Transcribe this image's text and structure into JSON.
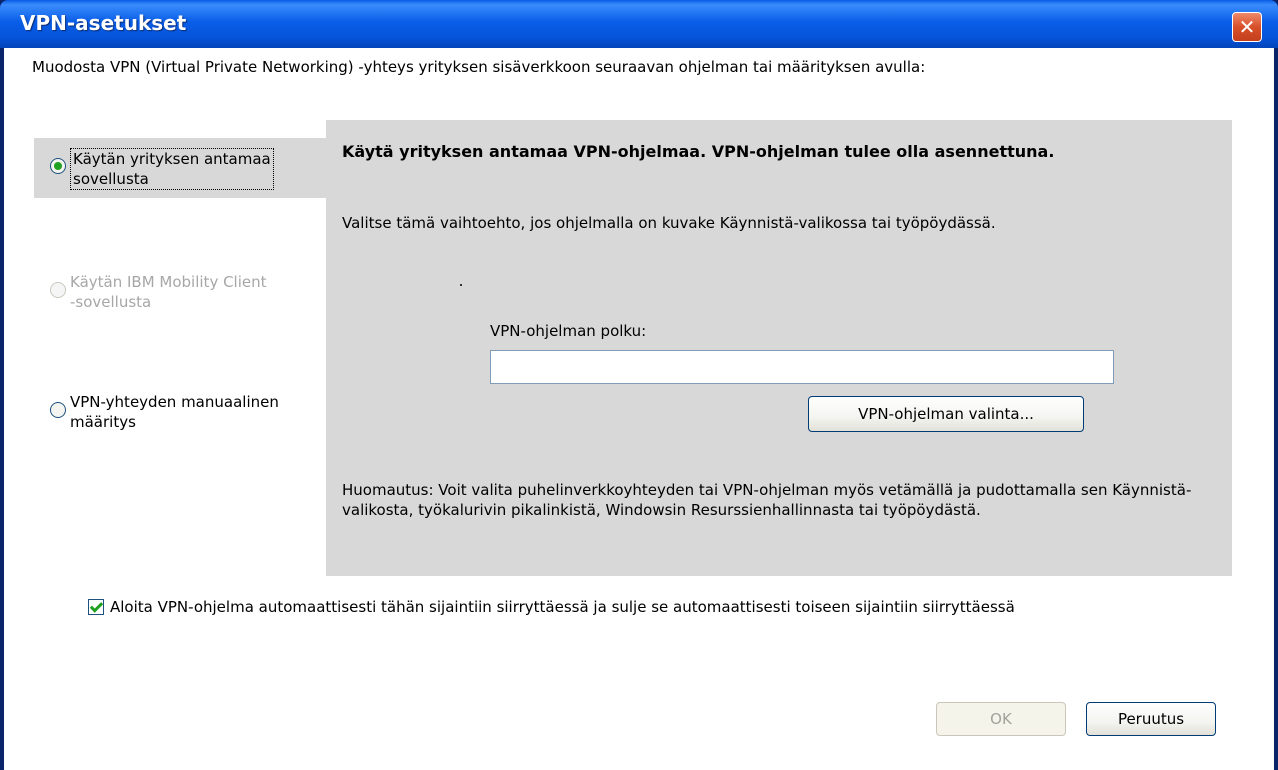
{
  "window": {
    "title": "VPN-asetukset",
    "close_glyph": "✕",
    "close_icon": "close-icon"
  },
  "intro_text": "Muodosta VPN (Virtual Private Networking) -yhteys yrityksen sisäverkkoon seuraavan ohjelman tai määrityksen avulla:",
  "options": [
    {
      "label_line1": "Käytän yrityksen antamaa",
      "label_line2": "sovellusta",
      "selected": true,
      "enabled": true
    },
    {
      "label_line1": "Käytän IBM Mobility Client",
      "label_line2": "-sovellusta",
      "selected": false,
      "enabled": false
    },
    {
      "label_line1": "VPN-yhteyden manuaalinen",
      "label_line2": "määritys",
      "selected": false,
      "enabled": true
    }
  ],
  "panel": {
    "heading": "Käytä yrityksen antamaa VPN-ohjelmaa. VPN-ohjelman tulee olla asennettuna.",
    "description": "Valitse tämä vaihtoehto, jos ohjelmalla on kuvake Käynnistä-valikossa tai työpöydässä.",
    "path_label": "VPN-ohjelman polku:",
    "path_value": "",
    "browse_button": "VPN-ohjelman valinta...",
    "note": "Huomautus: Voit valita puhelinverkkoyhteyden tai VPN-ohjelman myös vetämällä ja pudottamalla sen Käynnistä-valikosta, työkalurivin pikalinkistä, Windowsin Resurssienhallinnasta tai työpöydästä."
  },
  "auto_start": {
    "label": "Aloita VPN-ohjelma automaattisesti tähän sijaintiin siirryttäessä ja sulje se automaattisesti toiseen sijaintiin siirryttäessä",
    "checked": true
  },
  "buttons": {
    "ok": "OK",
    "ok_enabled": false,
    "cancel": "Peruutus"
  },
  "colors": {
    "title_bar": "#0a5ee8",
    "panel_background": "#d8d8d8",
    "close_button": "#d8502a",
    "check_accent": "#21a121"
  }
}
